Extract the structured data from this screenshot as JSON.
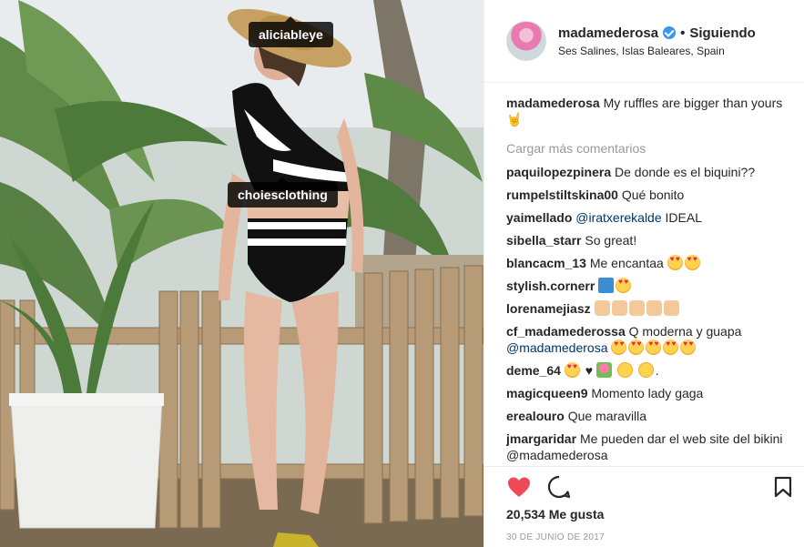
{
  "photo": {
    "tags": [
      {
        "label": "aliciableye"
      },
      {
        "label": "choiesclothing"
      }
    ]
  },
  "header": {
    "username": "madamederosa",
    "verified": true,
    "separator": "•",
    "follow_status": "Siguiendo",
    "location": "Ses Salines, Islas Baleares, Spain"
  },
  "caption": {
    "user": "madamederosa",
    "text": "My ruffles are bigger than yours 🤘"
  },
  "load_more_label": "Cargar más comentarios",
  "comments": [
    {
      "user": "paquilopezpinera",
      "text": "De donde es el biquini??"
    },
    {
      "user": "rumpelstiltskina00",
      "text": "Qué bonito"
    },
    {
      "user": "yaimellado",
      "mention": "@iratxerekalde",
      "text": "IDEAL"
    },
    {
      "user": "sibella_starr",
      "text": "So great!"
    },
    {
      "user": "blancacm_13",
      "text": "Me encantaa",
      "emoji": [
        "heart-eyes",
        "heart-eyes"
      ]
    },
    {
      "user": "stylish.cornerr",
      "text": "",
      "emoji": [
        "up-arrow",
        "heart-eyes"
      ]
    },
    {
      "user": "lorenamejiasz",
      "text": "",
      "emoji": [
        "pray",
        "pray",
        "pray",
        "pray",
        "pray"
      ]
    },
    {
      "user": "cf_madamederossa",
      "text": "Q moderna y guapa",
      "mention": "@madamederosa",
      "emoji": [
        "heart-eyes",
        "heart-eyes",
        "heart-eyes",
        "heart-eyes",
        "heart-eyes"
      ]
    },
    {
      "user": "deme_64",
      "text": "",
      "emoji": [
        "heart-eyes",
        "black-heart",
        "tulip",
        "wink",
        "wink"
      ],
      "suffix": "."
    },
    {
      "user": "magicqueen9",
      "text": "Momento lady gaga"
    },
    {
      "user": "erealouro",
      "text": "Que maravilla"
    },
    {
      "user": "jmargaridar",
      "text": "Me pueden dar el web site del bikini @madamederosa"
    }
  ],
  "actions": {
    "liked": true,
    "like_icon": "heart-icon",
    "comment_icon": "comment-icon",
    "save_icon": "bookmark-icon",
    "likes_text": "20,534 Me gusta",
    "date": "30 DE JUNIO DE 2017"
  },
  "colors": {
    "like_red": "#ed4956",
    "link_blue": "#003569",
    "muted": "#999999",
    "verified_blue": "#3897f0"
  }
}
